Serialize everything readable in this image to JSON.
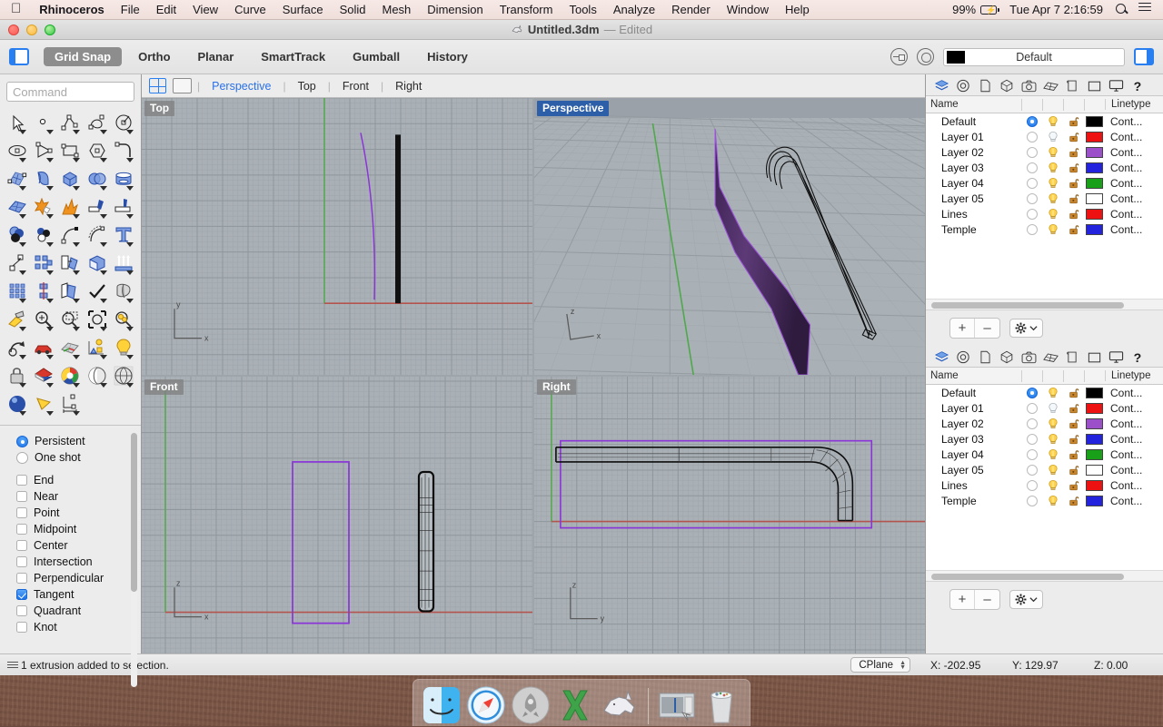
{
  "menubar": {
    "apple": "apple-logo",
    "app": "Rhinoceros",
    "items": [
      "File",
      "Edit",
      "View",
      "Curve",
      "Surface",
      "Solid",
      "Mesh",
      "Dimension",
      "Transform",
      "Tools",
      "Analyze",
      "Render",
      "Window",
      "Help"
    ],
    "battery": "99%",
    "clock": "Tue Apr 7  2:16:59"
  },
  "window": {
    "title": "Untitled.3dm",
    "edited": "— Edited"
  },
  "toolbar": {
    "toggles": [
      {
        "label": "Grid Snap",
        "on": true
      },
      {
        "label": "Ortho",
        "on": false
      },
      {
        "label": "Planar",
        "on": false
      },
      {
        "label": "SmartTrack",
        "on": false
      },
      {
        "label": "Gumball",
        "on": false
      },
      {
        "label": "History",
        "on": false
      }
    ],
    "layer_color": "#000000",
    "layer_name": "Default"
  },
  "sidebar": {
    "command_placeholder": "Command",
    "tools": [
      "select-arrow-tool",
      "point-tool",
      "polyline-tool",
      "curve-tool",
      "circle-tool",
      "ellipse-tool",
      "arc-tool",
      "rectangle-tool",
      "polygon-tool",
      "fillet-curve-tool",
      "surface-srf-pt-tool",
      "loft-tool",
      "box-tool",
      "sphere-boolean-tool",
      "cylinder-tool",
      "surface-grid-tool",
      "explode-star-tool",
      "fireworks-tool",
      "trim-tool",
      "split-tool",
      "boolean-union-tool",
      "boolean-difference-tool",
      "blend-curve-tool",
      "offset-curve-tool",
      "text-tool",
      "move-tool",
      "array-tool",
      "mirror-tool",
      "cap-tool",
      "extrude-tool",
      "rectangular-array-tool",
      "revolve-tool",
      "flow-tool",
      "check-tool",
      "shade-tool",
      "render-tool",
      "zoom-tool",
      "zoom-window-tool",
      "zoom-extents-tool",
      "zoom-selected-tool",
      "undo-view-tool",
      "car-tool",
      "grid-tool",
      "layout-tool",
      "light-tool",
      "lock-tool",
      "shade-mode-tool",
      "color-wheel-tool",
      "sphere-shade-tool",
      "sphere-grid-tool",
      "render-sphere-tool",
      "camera-tool",
      "dimension-tool"
    ],
    "osnap": {
      "modes": [
        {
          "label": "Persistent",
          "type": "radio",
          "checked": true
        },
        {
          "label": "One shot",
          "type": "radio",
          "checked": false
        }
      ],
      "snaps": [
        {
          "label": "End",
          "checked": false
        },
        {
          "label": "Near",
          "checked": false
        },
        {
          "label": "Point",
          "checked": false
        },
        {
          "label": "Midpoint",
          "checked": false
        },
        {
          "label": "Center",
          "checked": false
        },
        {
          "label": "Intersection",
          "checked": false
        },
        {
          "label": "Perpendicular",
          "checked": false
        },
        {
          "label": "Tangent",
          "checked": true
        },
        {
          "label": "Quadrant",
          "checked": false
        },
        {
          "label": "Knot",
          "checked": false
        }
      ]
    }
  },
  "viewports": {
    "tabs": [
      {
        "label": "Perspective",
        "active": true
      },
      {
        "label": "Top",
        "active": false
      },
      {
        "label": "Front",
        "active": false
      },
      {
        "label": "Right",
        "active": false
      }
    ],
    "panes": [
      {
        "label": "Top",
        "highlight": false,
        "axes": [
          "y",
          "x"
        ]
      },
      {
        "label": "Perspective",
        "highlight": true,
        "axes": [
          "z",
          "x"
        ]
      },
      {
        "label": "Front",
        "highlight": false,
        "axes": [
          "z",
          "x"
        ]
      },
      {
        "label": "Right",
        "highlight": false,
        "axes": [
          "z",
          "y"
        ]
      }
    ]
  },
  "layer_panel": {
    "tabs": [
      "layers-icon",
      "properties-icon",
      "page-icon",
      "object-icon",
      "camera-icon",
      "render-icon",
      "notes-icon",
      "display-icon",
      "monitor-icon",
      "help-icon"
    ],
    "columns": [
      "Name",
      "Linetype"
    ],
    "rows": [
      {
        "name": "Default",
        "current": true,
        "on": true,
        "locked": false,
        "color": "#000000",
        "linetype": "Cont..."
      },
      {
        "name": "Layer 01",
        "current": false,
        "on": false,
        "locked": false,
        "color": "#ee1111",
        "linetype": "Cont..."
      },
      {
        "name": "Layer 02",
        "current": false,
        "on": true,
        "locked": false,
        "color": "#9b4fc8",
        "linetype": "Cont..."
      },
      {
        "name": "Layer 03",
        "current": false,
        "on": true,
        "locked": false,
        "color": "#2323dd",
        "linetype": "Cont..."
      },
      {
        "name": "Layer 04",
        "current": false,
        "on": true,
        "locked": false,
        "color": "#19a019",
        "linetype": "Cont..."
      },
      {
        "name": "Layer 05",
        "current": false,
        "on": true,
        "locked": false,
        "color": "#ffffff",
        "linetype": "Cont..."
      },
      {
        "name": "Lines",
        "current": false,
        "on": true,
        "locked": false,
        "color": "#ee1111",
        "linetype": "Cont..."
      },
      {
        "name": "Temple",
        "current": false,
        "on": true,
        "locked": false,
        "color": "#2323dd",
        "linetype": "Cont..."
      }
    ],
    "add_label": "+",
    "remove_label": "–"
  },
  "statusbar": {
    "message": "1 extrusion added to selection.",
    "cplane": "CPlane",
    "x": "X: -202.95",
    "y": "Y: 129.97",
    "z": "Z: 0.00"
  },
  "dock": {
    "items": [
      "finder-icon",
      "safari-icon",
      "launchpad-icon",
      "excel-icon",
      "rhinoceros-icon",
      "minimized-window-icon",
      "trash-icon"
    ]
  }
}
